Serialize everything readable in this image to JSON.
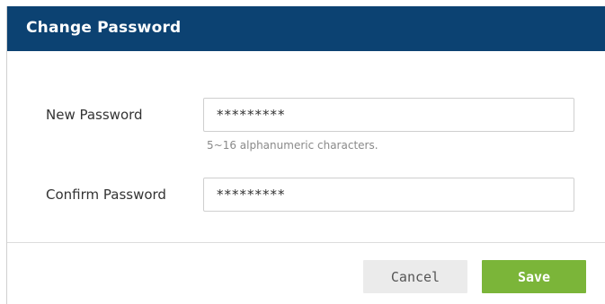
{
  "dialog": {
    "title": "Change Password"
  },
  "form": {
    "new_password": {
      "label": "New Password",
      "value": "*********",
      "hint": "5~16 alphanumeric characters."
    },
    "confirm_password": {
      "label": "Confirm Password",
      "value": "*********"
    }
  },
  "footer": {
    "cancel_label": "Cancel",
    "save_label": "Save"
  },
  "colors": {
    "header_bg": "#0c4272",
    "save_bg": "#7bb539",
    "cancel_bg": "#ebebeb"
  }
}
